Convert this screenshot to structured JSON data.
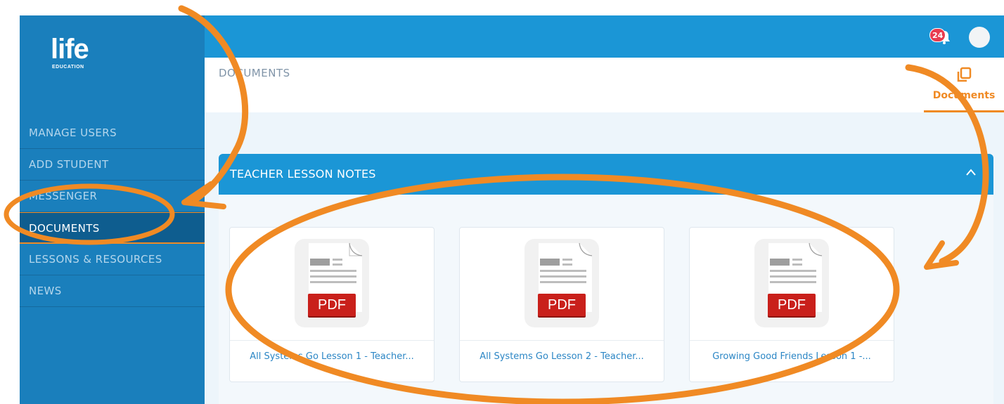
{
  "brand": {
    "logo_word": "life",
    "logo_sub": "EDUCATION"
  },
  "sidebar": {
    "items": [
      {
        "label": "MANAGE USERS",
        "active": false
      },
      {
        "label": "ADD STUDENT",
        "active": false
      },
      {
        "label": "MESSENGER",
        "active": false
      },
      {
        "label": "DOCUMENTS",
        "active": true
      },
      {
        "label": "LESSONS & RESOURCES",
        "active": false
      },
      {
        "label": "NEWS",
        "active": false
      }
    ]
  },
  "topbar": {
    "notification_count": "24",
    "bell_icon": "bell-icon",
    "avatar_icon": "user-avatar"
  },
  "page": {
    "title": "DOCUMENTS",
    "tab_label": "Documents",
    "tab_icon": "documents-icon"
  },
  "panel": {
    "title": "TEACHER LESSON NOTES",
    "collapse_icon": "chevron-up-icon"
  },
  "documents": [
    {
      "name": "All Systems Go Lesson 1 - Teacher...",
      "type_label": "PDF"
    },
    {
      "name": "All Systems Go Lesson 2 - Teacher...",
      "type_label": "PDF"
    },
    {
      "name": "Growing Good Friends Lesson 1 -...",
      "type_label": "PDF"
    }
  ],
  "colors": {
    "sidebar": "#1a7fbc",
    "topbar": "#1b96d6",
    "accent": "#f08a24",
    "badge": "#e83c4f",
    "pdf_red": "#c9201b",
    "link": "#2b86c5"
  }
}
